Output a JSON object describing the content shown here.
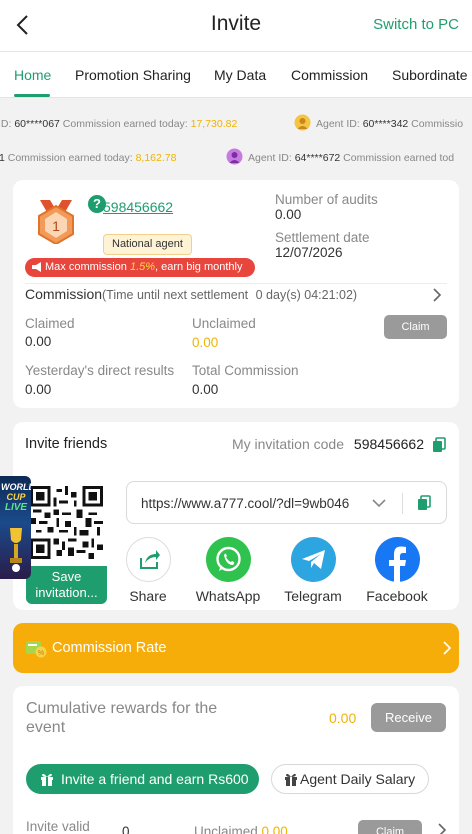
{
  "header": {
    "title": "Invite",
    "switch_label": "Switch to PC"
  },
  "tabs": [
    "Home",
    "Promotion Sharing",
    "My Data",
    "Commission",
    "Subordinate I"
  ],
  "marquee": {
    "row1": [
      {
        "prefix": "ID: ",
        "id": "60****067",
        "text": " Commission earned today: ",
        "amount": "17,730.82"
      },
      {
        "prefix": "Agent ID: ",
        "id": "60****342",
        "text": " Commissio",
        "amount": ""
      }
    ],
    "row2": [
      {
        "prefix": "",
        "id": "1",
        "text": " Commission earned today: ",
        "amount": "8,162.78"
      },
      {
        "prefix": "Agent ID: ",
        "id": "64****672",
        "text": " Commission earned tod",
        "amount": ""
      }
    ]
  },
  "agent": {
    "rank": "1",
    "user_id": "598456662",
    "badge": "National agent",
    "max_commission_prefix": "Max commission ",
    "max_commission_rate": "1.5%",
    "max_commission_suffix": ", earn big monthly",
    "audits_label": "Number of audits",
    "audits_value": "0.00",
    "settlement_label": "Settlement date",
    "settlement_value": "12/07/2026"
  },
  "commission": {
    "title": "Commission",
    "countdown_label": "(Time until next settlement ",
    "countdown_value": "0 day(s) 04:21:02)",
    "claimed_label": "Claimed",
    "claimed_value": "0.00",
    "unclaimed_label": "Unclaimed",
    "unclaimed_value": "0.00",
    "claim_button": "Claim",
    "yesterday_label": "Yesterday's direct results",
    "yesterday_value": "0.00",
    "total_label": "Total Commission",
    "total_value": "0.00"
  },
  "invite": {
    "title": "Invite friends",
    "code_label": "My invitation code",
    "code_value": "598456662",
    "save_label": "Save invitation...",
    "url": "https://www.a777.cool/?dl=9wb046",
    "promo_lines": [
      "WORLD",
      "CUP",
      "LIVE"
    ],
    "share_options": [
      "Share",
      "WhatsApp",
      "Telegram",
      "Facebook"
    ]
  },
  "rate": {
    "label": "Commission Rate"
  },
  "rewards": {
    "label": "Cumulative rewards for the event",
    "value": "0.00",
    "receive_button": "Receive",
    "invite_earn": "Invite a friend and earn Rs600",
    "agent_salary": "Agent Daily Salary",
    "invite_valid_label": "Invite valid",
    "invite_valid_value": "0",
    "unclaimed_label": "Unclaimed ",
    "unclaimed_value": "0.00",
    "claim_button": "Claim"
  },
  "colors": {
    "accent": "#1e9e6e",
    "gold": "#f0b400",
    "orange": "#f6ad0a",
    "red": "#e8453c"
  }
}
